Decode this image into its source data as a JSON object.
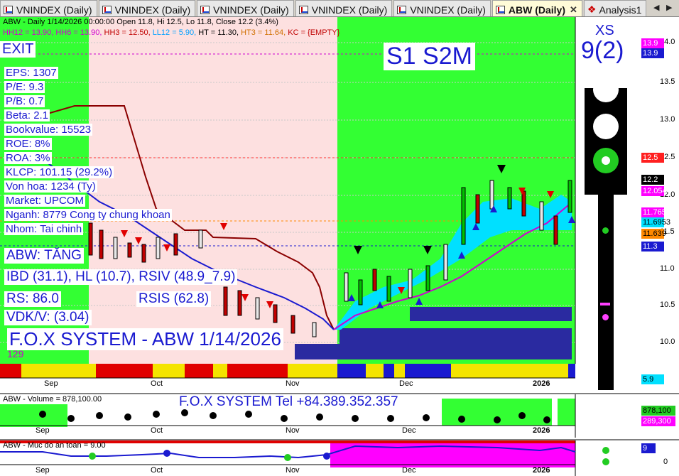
{
  "tabs": [
    {
      "label": "VNINDEX (Daily)",
      "active": false
    },
    {
      "label": "VNINDEX (Daily)",
      "active": false
    },
    {
      "label": "VNINDEX (Daily)",
      "active": false
    },
    {
      "label": "VNINDEX (Daily)",
      "active": false
    },
    {
      "label": "VNINDEX (Daily)",
      "active": false
    },
    {
      "label": "ABW (Daily)",
      "active": true
    },
    {
      "label": "Analysis1",
      "active": false
    }
  ],
  "main": {
    "header": "ABW - Daily 1/14/2026 00:00:00 Open 11.8, Hi 12.5, Lo 11.8, Close 12.2 (3.4%)",
    "levels": [
      {
        "text": "HH12 = 13.90,",
        "color": "#d000d0"
      },
      {
        "text": "HH6 = 13.90,",
        "color": "#d000d0"
      },
      {
        "text": "HH3 = 12.50,",
        "color": "#c00000"
      },
      {
        "text": "LL12 = 5.90,",
        "color": "#00a0ff"
      },
      {
        "text": "HT = 11.30,",
        "color": "#000000"
      },
      {
        "text": "HT3 = 11.64,",
        "color": "#d07000"
      },
      {
        "text": "KC = {EMPTY}",
        "color": "#c00000"
      }
    ],
    "exit_label": "EXIT",
    "fundamentals": [
      "EPS: 1307",
      "P/E: 9.3",
      "P/B: 0.7",
      "Beta: 2.1",
      "Bookvalue: 15523",
      "ROE: 8%",
      "ROA: 3%",
      "KLCP: 101.15 (29.2%)",
      "Von hoa: 1234 (Ty)",
      "Market: UPCOM",
      "Nganh: 8779 Cong ty chung khoan",
      "Nhom: Tai chinh"
    ],
    "trend": "ABW: TĂNG",
    "ibd": "IBD (31.1), HL (10.7), RSIV (48.9_7.9)",
    "rs": "RS: 86.0",
    "rsis": "RSIS (62.8)",
    "vdkv": "VDK/V:  (3.04)",
    "watermark": "F.O.X SYSTEM - ABW 1/14/2026",
    "count": "129",
    "signal": "S1  S2M",
    "xs_label": "XS",
    "xs_value": "9(2)",
    "y_axis": [
      "14.0",
      "13.5",
      "13.0",
      "12.5",
      "12.0",
      "11.5",
      "11.0",
      "10.5",
      "10.0"
    ],
    "price_tags": [
      {
        "value": "13.9",
        "bg": "#ff00ff",
        "fg": "#ffffff"
      },
      {
        "value": "13.9",
        "bg": "#1a1ad0",
        "fg": "#ffffff"
      },
      {
        "value": "12.5",
        "bg": "#ff2020",
        "fg": "#ffffff"
      },
      {
        "value": "12.2",
        "bg": "#000000",
        "fg": "#ffffff"
      },
      {
        "value": "12.0544",
        "bg": "#ff00ff",
        "fg": "#ffffff"
      },
      {
        "value": "11.765",
        "bg": "#ff00ff",
        "fg": "#ffffff"
      },
      {
        "value": "11.6953",
        "bg": "#00e0ff",
        "fg": "#000000"
      },
      {
        "value": "11.639",
        "bg": "#ff8800",
        "fg": "#000000"
      },
      {
        "value": "11.3",
        "bg": "#1a1ad0",
        "fg": "#ffffff"
      },
      {
        "value": "5.9",
        "bg": "#00e0ff",
        "fg": "#000000"
      }
    ],
    "x_axis": [
      "Sep",
      "Oct",
      "Nov",
      "Dec",
      "2026"
    ]
  },
  "volume": {
    "header": "ABW - Volume = 878,100.00",
    "phone": "F.O.X SYSTEM Tel +84.389.352.357",
    "tag_top": "878,100",
    "tag_bottom": "289,300"
  },
  "safety": {
    "header": "ABW - Muc do an toan = 9.00",
    "tag": "9",
    "axis_zero": "0"
  },
  "colors": {
    "green_zone": "#33ff33",
    "pink_zone": "#fde0e0",
    "text_blue": "#1a1ad0",
    "navy_box": "#2a2aa0"
  }
}
